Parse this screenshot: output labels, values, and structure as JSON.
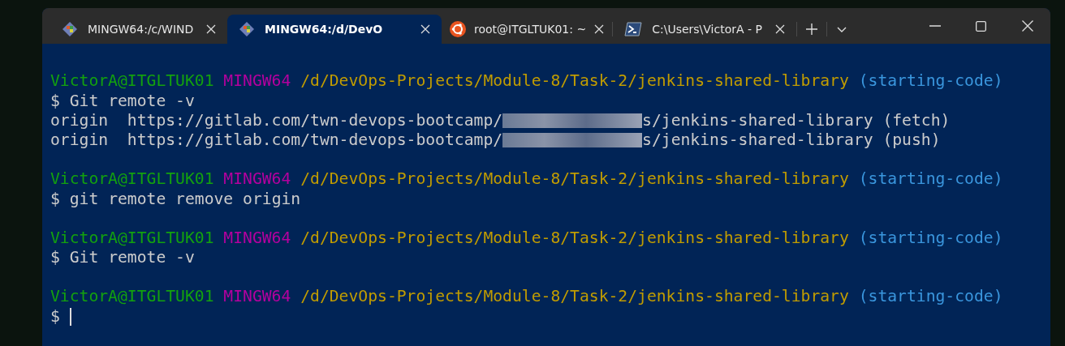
{
  "tabs": [
    {
      "title": "MINGW64:/c/WIND",
      "kind": "gitbash",
      "selected": false
    },
    {
      "title": "MINGW64:/d/DevO",
      "kind": "gitbash",
      "selected": true
    },
    {
      "title": "root@ITGLTUK01: ~",
      "kind": "ubuntu",
      "selected": false
    },
    {
      "title": "C:\\Users\\VictorA - P",
      "kind": "powershell",
      "selected": false
    }
  ],
  "blocks": [
    [
      {
        "kind": "prompt",
        "user": "VictorA@ITGLTUK01",
        "system": "MINGW64",
        "path": "/d/DevOps-Projects/Module-8/Task-2/jenkins-shared-library",
        "branch": "(starting-code)"
      },
      {
        "kind": "command",
        "symbol": "$",
        "text": "Git remote -v"
      },
      {
        "kind": "output",
        "before": "origin  https://gitlab.com/twn-devops-bootcamp/",
        "after": "s/jenkins-shared-library (fetch)"
      },
      {
        "kind": "output",
        "before": "origin  https://gitlab.com/twn-devops-bootcamp/",
        "after": "s/jenkins-shared-library (push)"
      }
    ],
    [
      {
        "kind": "prompt",
        "user": "VictorA@ITGLTUK01",
        "system": "MINGW64",
        "path": "/d/DevOps-Projects/Module-8/Task-2/jenkins-shared-library",
        "branch": "(starting-code)"
      },
      {
        "kind": "command",
        "symbol": "$",
        "text": "git remote remove origin"
      }
    ],
    [
      {
        "kind": "prompt",
        "user": "VictorA@ITGLTUK01",
        "system": "MINGW64",
        "path": "/d/DevOps-Projects/Module-8/Task-2/jenkins-shared-library",
        "branch": "(starting-code)"
      },
      {
        "kind": "command",
        "symbol": "$",
        "text": "Git remote -v"
      }
    ],
    [
      {
        "kind": "prompt",
        "user": "VictorA@ITGLTUK01",
        "system": "MINGW64",
        "path": "/d/DevOps-Projects/Module-8/Task-2/jenkins-shared-library",
        "branch": "(starting-code)"
      },
      {
        "kind": "command",
        "symbol": "$",
        "cursor": true
      }
    ]
  ]
}
